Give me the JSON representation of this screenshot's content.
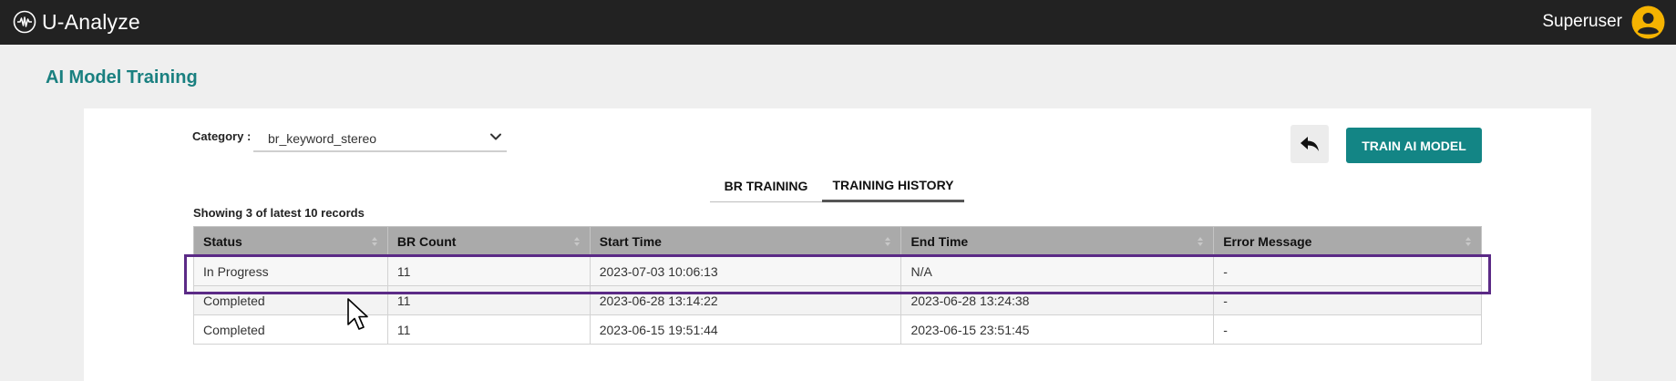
{
  "app": {
    "name": "U-Analyze",
    "user_name": "Superuser"
  },
  "page": {
    "title": "AI Model Training"
  },
  "category": {
    "label": "Category :",
    "value": "br_keyword_stereo"
  },
  "toolbar": {
    "train_label": "TRAIN AI MODEL"
  },
  "tabs": [
    {
      "label": "BR TRAINING",
      "active": false
    },
    {
      "label": "TRAINING HISTORY",
      "active": true
    }
  ],
  "records_info": "Showing 3 of latest 10 records",
  "table": {
    "columns": [
      "Status",
      "BR Count",
      "Start Time",
      "End Time",
      "Error Message"
    ],
    "rows": [
      [
        "In Progress",
        "11",
        "2023-07-03 10:06:13",
        "N/A",
        "-"
      ],
      [
        "Completed",
        "11",
        "2023-06-28 13:14:22",
        "2023-06-28 13:24:38",
        "-"
      ],
      [
        "Completed",
        "11",
        "2023-06-15 19:51:44",
        "2023-06-15 23:51:45",
        "-"
      ]
    ]
  },
  "colors": {
    "topbar": "#222222",
    "accent": "#138585",
    "title": "#1a8080",
    "highlight": "#5b2a86",
    "avatar": "#f5b301"
  },
  "icons": {
    "brand": "waveform-circle-icon",
    "user": "user-avatar-icon",
    "back": "reply-arrow-icon",
    "dropdown": "chevron-down-icon",
    "sort": "sort-arrows-icon",
    "cursor": "mouse-pointer-icon"
  }
}
